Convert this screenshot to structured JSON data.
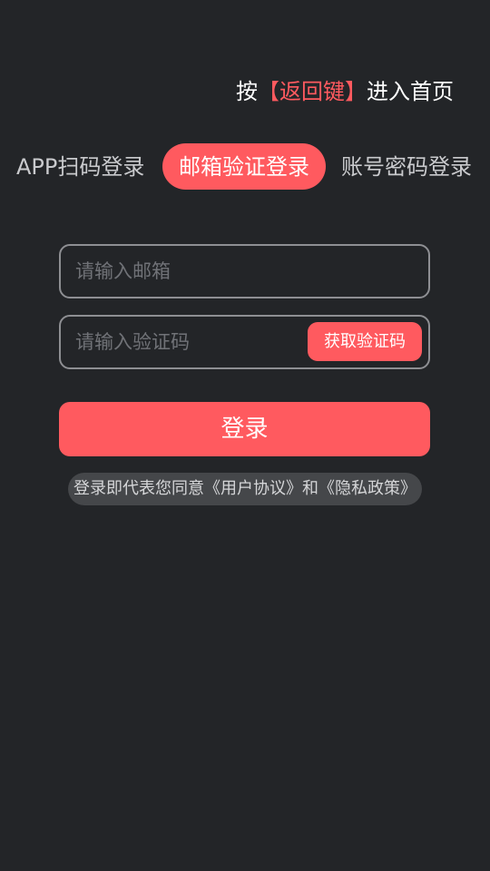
{
  "hint": {
    "prefix": "按",
    "key": "【返回键】",
    "suffix": "进入首页"
  },
  "tabs": [
    {
      "label": "APP扫码登录",
      "active": false
    },
    {
      "label": "邮箱验证登录",
      "active": true
    },
    {
      "label": "账号密码登录",
      "active": false
    }
  ],
  "form": {
    "email": {
      "placeholder": "请输入邮箱",
      "value": ""
    },
    "code": {
      "placeholder": "请输入验证码",
      "value": ""
    },
    "get_code_label": "获取验证码",
    "login_label": "登录"
  },
  "agreement": {
    "prefix": "登录即代表您同意",
    "user_agreement": "《用户协议》",
    "and": "和",
    "privacy_policy": "《隐私政策》"
  },
  "colors": {
    "background": "#232528",
    "accent": "#ff5a5f",
    "text_primary": "#ffffff",
    "text_muted": "#c9cacd"
  }
}
